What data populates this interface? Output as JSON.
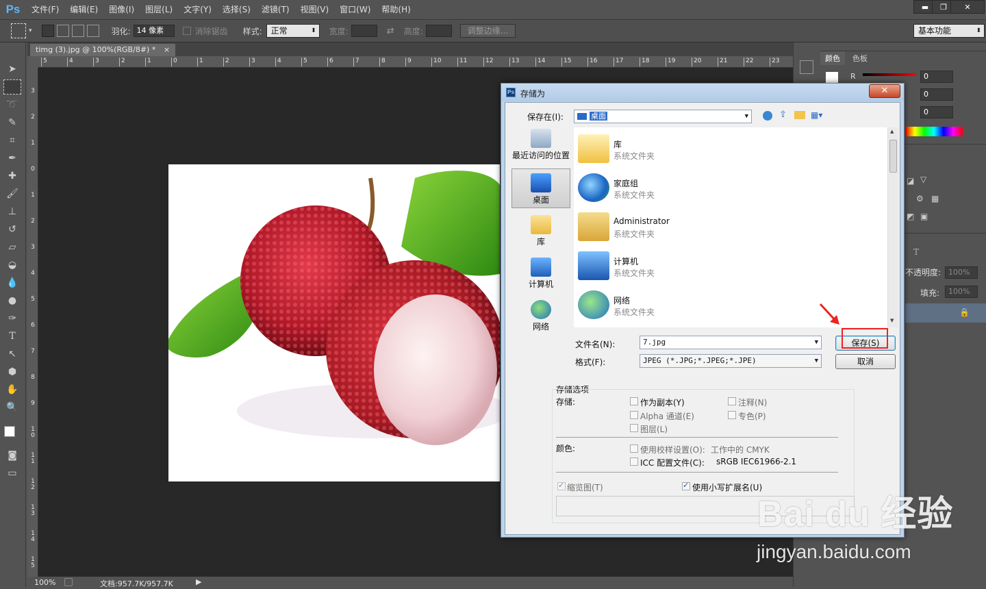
{
  "app": {
    "logo": "Ps"
  },
  "menu": [
    "文件(F)",
    "编辑(E)",
    "图像(I)",
    "图层(L)",
    "文字(Y)",
    "选择(S)",
    "滤镜(T)",
    "视图(V)",
    "窗口(W)",
    "帮助(H)"
  ],
  "window_controls": {
    "minimize": "▬",
    "restore": "❐",
    "close": "✕"
  },
  "options": {
    "feather_label": "羽化:",
    "feather_value": "14 像素",
    "antialias_label": "消除锯齿",
    "style_label": "样式:",
    "style_value": "正常",
    "width_label": "宽度:",
    "height_label": "高度:",
    "refine_edge_label": "调整边缘...",
    "workspace_value": "基本功能"
  },
  "document": {
    "tab_title": "timg (3).jpg @ 100%(RGB/8#) *",
    "zoom": "100%",
    "doc_info": "文档:957.7K/957.7K",
    "ruler_h": [
      "5",
      "4",
      "3",
      "2",
      "1",
      "0",
      "1",
      "2",
      "3",
      "4",
      "5",
      "6",
      "7",
      "8",
      "9",
      "10",
      "11",
      "12",
      "13",
      "14",
      "15",
      "16",
      "17",
      "18",
      "19",
      "20",
      "21",
      "22",
      "23"
    ],
    "ruler_v": [
      "3",
      "2",
      "1",
      "0",
      "1",
      "2",
      "3",
      "4",
      "5",
      "6",
      "7",
      "8",
      "9",
      "10",
      "11",
      "12",
      "13",
      "14",
      "15"
    ]
  },
  "panels": {
    "color_tab": "颜色",
    "swatches_tab": "色板",
    "r_label": "R",
    "r_value": "0",
    "g_value": "0",
    "b_value": "0",
    "opacity_label": "不透明度:",
    "opacity_value": "100%",
    "fill_label": "填充:",
    "fill_value": "100%"
  },
  "dialog": {
    "title": "存储为",
    "save_in_label": "保存在(I):",
    "save_in_value": "桌面",
    "places": [
      {
        "label": "最近访问的位置"
      },
      {
        "label": "桌面"
      },
      {
        "label": "库"
      },
      {
        "label": "计算机"
      },
      {
        "label": "网络"
      }
    ],
    "files": [
      {
        "name": "库",
        "type": "系统文件夹"
      },
      {
        "name": "家庭组",
        "type": "系统文件夹"
      },
      {
        "name": "Administrator",
        "type": "系统文件夹"
      },
      {
        "name": "计算机",
        "type": "系统文件夹"
      },
      {
        "name": "网络",
        "type": "系统文件夹"
      }
    ],
    "filename_label": "文件名(N):",
    "filename_value": "7.jpg",
    "format_label": "格式(F):",
    "format_value": "JPEG (*.JPG;*.JPEG;*.JPE)",
    "save_button": "保存(S)",
    "cancel_button": "取消",
    "save_options_title": "存储选项",
    "save_label": "存储:",
    "as_copy": "作为副本(Y)",
    "notes": "注释(N)",
    "alpha_channels": "Alpha 通道(E)",
    "spot_colors": "专色(P)",
    "layers": "图层(L)",
    "color_label": "颜色:",
    "use_proof": "使用校样设置(O):",
    "proof_value": "工作中的 CMYK",
    "icc_profile": "ICC 配置文件(C):",
    "icc_value": "sRGB IEC61966-2.1",
    "thumbnail": "缩览图(T)",
    "lowercase_ext": "使用小写扩展名(U)"
  },
  "watermark": {
    "logo": "Bai du 经验",
    "url": "jingyan.baidu.com"
  },
  "colors": {
    "highlight": "#ee2222",
    "arrow": "#ee2222",
    "ps_blue": "#5eb5f7"
  }
}
